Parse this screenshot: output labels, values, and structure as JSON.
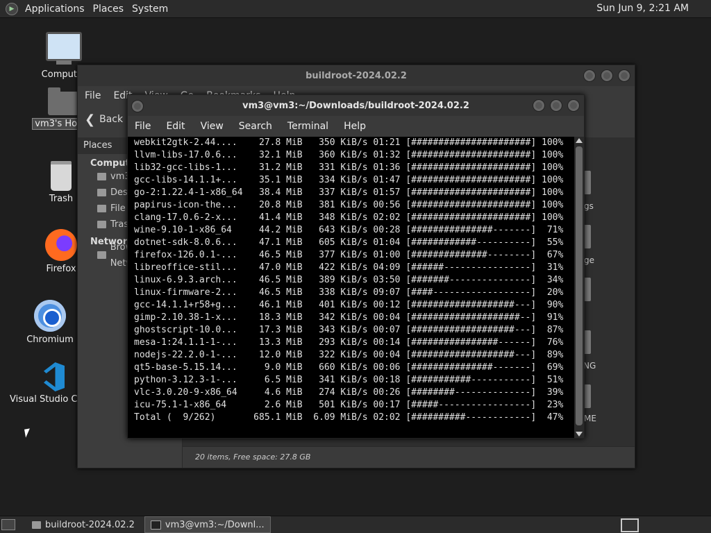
{
  "top_panel": {
    "menu": [
      "Applications",
      "Places",
      "System"
    ],
    "clock": "Sun Jun  9,  2:21 AM"
  },
  "desktop": {
    "icons": [
      {
        "label": "Computer",
        "icon": "computer-icon"
      },
      {
        "label": "vm3's Home",
        "icon": "home-folder-icon"
      },
      {
        "label": "Trash",
        "icon": "trash-icon"
      },
      {
        "label": "Firefox",
        "icon": "firefox-icon"
      },
      {
        "label": "Chromium",
        "icon": "chromium-icon"
      },
      {
        "label": "Visual Studio Code",
        "icon": "vscode-icon"
      }
    ]
  },
  "file_manager": {
    "title": "buildroot-2024.02.2",
    "menu": [
      "File",
      "Edit",
      "View",
      "Go",
      "Bookmarks",
      "Help"
    ],
    "back_label": "Back",
    "places_header": "Places",
    "sections": [
      {
        "name": "Computer",
        "items": [
          "vm3",
          "Desktop",
          "File System",
          "Trash"
        ]
      },
      {
        "name": "Network",
        "items": [
          "Browse Network"
        ]
      }
    ],
    "visible_file_labels": [
      "gs",
      "ge",
      "NG",
      "ME"
    ],
    "status": "20 items, Free space: 27.8 GB"
  },
  "terminal": {
    "title": "vm3@vm3:~/Downloads/buildroot-2024.02.2",
    "menu": [
      "File",
      "Edit",
      "View",
      "Search",
      "Terminal",
      "Help"
    ],
    "lines": [
      "webkit2gtk-2.44....    27.8 MiB   350 KiB/s 01:21 [######################] 100%",
      "llvm-libs-17.0.6...    32.1 MiB   360 KiB/s 01:32 [######################] 100%",
      "lib32-gcc-libs-1...    31.2 MiB   331 KiB/s 01:36 [######################] 100%",
      "gcc-libs-14.1.1+...    35.1 MiB   334 KiB/s 01:47 [######################] 100%",
      "go-2:1.22.4-1-x86_64   38.4 MiB   337 KiB/s 01:57 [######################] 100%",
      "papirus-icon-the...    20.8 MiB   381 KiB/s 00:56 [######################] 100%",
      "clang-17.0.6-2-x...    41.4 MiB   348 KiB/s 02:02 [######################] 100%",
      "wine-9.10-1-x86_64     44.2 MiB   643 KiB/s 00:28 [###############-------]  71%",
      "dotnet-sdk-8.0.6...    47.1 MiB   605 KiB/s 01:04 [############----------]  55%",
      "firefox-126.0.1-...    46.5 MiB   377 KiB/s 01:00 [##############--------]  67%",
      "libreoffice-stil...    47.0 MiB   422 KiB/s 04:09 [######----------------]  31%",
      "linux-6.9.3.arch...    46.5 MiB   389 KiB/s 03:50 [#######---------------]  34%",
      "linux-firmware-2...    46.5 MiB   338 KiB/s 09:07 [####------------------]  20%",
      "gcc-14.1.1+r58+g...    46.1 MiB   401 KiB/s 00:12 [###################---]  90%",
      "gimp-2.10.38-1-x...    18.3 MiB   342 KiB/s 00:04 [####################--]  91%",
      "ghostscript-10.0...    17.3 MiB   343 KiB/s 00:07 [###################---]  87%",
      "mesa-1:24.1.1-1-...    13.3 MiB   293 KiB/s 00:14 [################------]  76%",
      "nodejs-22.2.0-1-...    12.0 MiB   322 KiB/s 00:04 [###################---]  89%",
      "qt5-base-5.15.14...     9.0 MiB   660 KiB/s 00:06 [###############-------]  69%",
      "python-3.12.3-1-...     6.5 MiB   341 KiB/s 00:18 [###########-----------]  51%",
      "vlc-3.0.20-9-x86_64     4.6 MiB   274 KiB/s 00:26 [########--------------]  39%",
      "icu-75.1-1-x86_64       2.6 MiB   501 KiB/s 00:17 [#####-----------------]  23%",
      "Total (  9/262)       685.1 MiB  6.09 MiB/s 02:02 [##########------------]  47%"
    ]
  },
  "taskbar": {
    "tasks": [
      {
        "label": "buildroot-2024.02.2",
        "icon": "folder-icon",
        "active": false
      },
      {
        "label": "vm3@vm3:~/Downl...",
        "icon": "terminal-icon",
        "active": true
      }
    ]
  }
}
